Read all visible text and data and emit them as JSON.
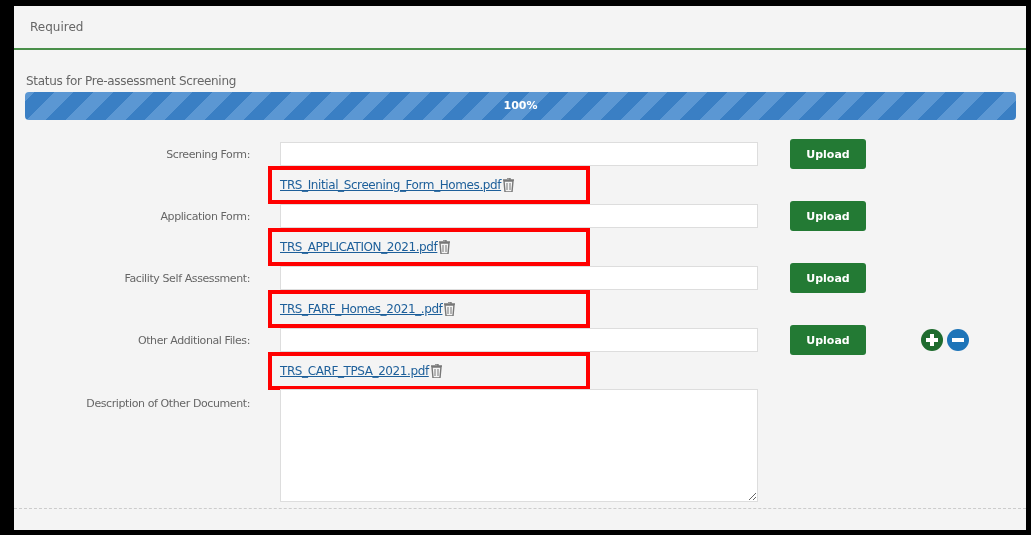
{
  "header": {
    "title": "Required"
  },
  "progress": {
    "label": "Status for Pre-assessment Screening",
    "level": 1,
    "reading": "100%"
  },
  "fields": [
    {
      "kind": "file",
      "label": "Screening Form:",
      "button": "Upload",
      "file": "TRS_Initial_Screening_Form_Homes.pdf",
      "highlighted": true,
      "add_remove": false
    },
    {
      "kind": "file",
      "label": "Application Form:",
      "button": "Upload",
      "file": "TRS_APPLICATION_2021.pdf",
      "highlighted": true,
      "add_remove": false
    },
    {
      "kind": "file",
      "label": "Facility Self Assessment:",
      "button": "Upload",
      "file": "TRS_FARF_Homes_2021_.pdf",
      "highlighted": true,
      "add_remove": false
    },
    {
      "kind": "file",
      "label": "Other Additional Files:",
      "button": "Upload",
      "file": "TRS_CARF_TPSA_2021.pdf",
      "highlighted": true,
      "add_remove": true
    },
    {
      "kind": "textarea",
      "label": "Description of Other Document:"
    }
  ]
}
